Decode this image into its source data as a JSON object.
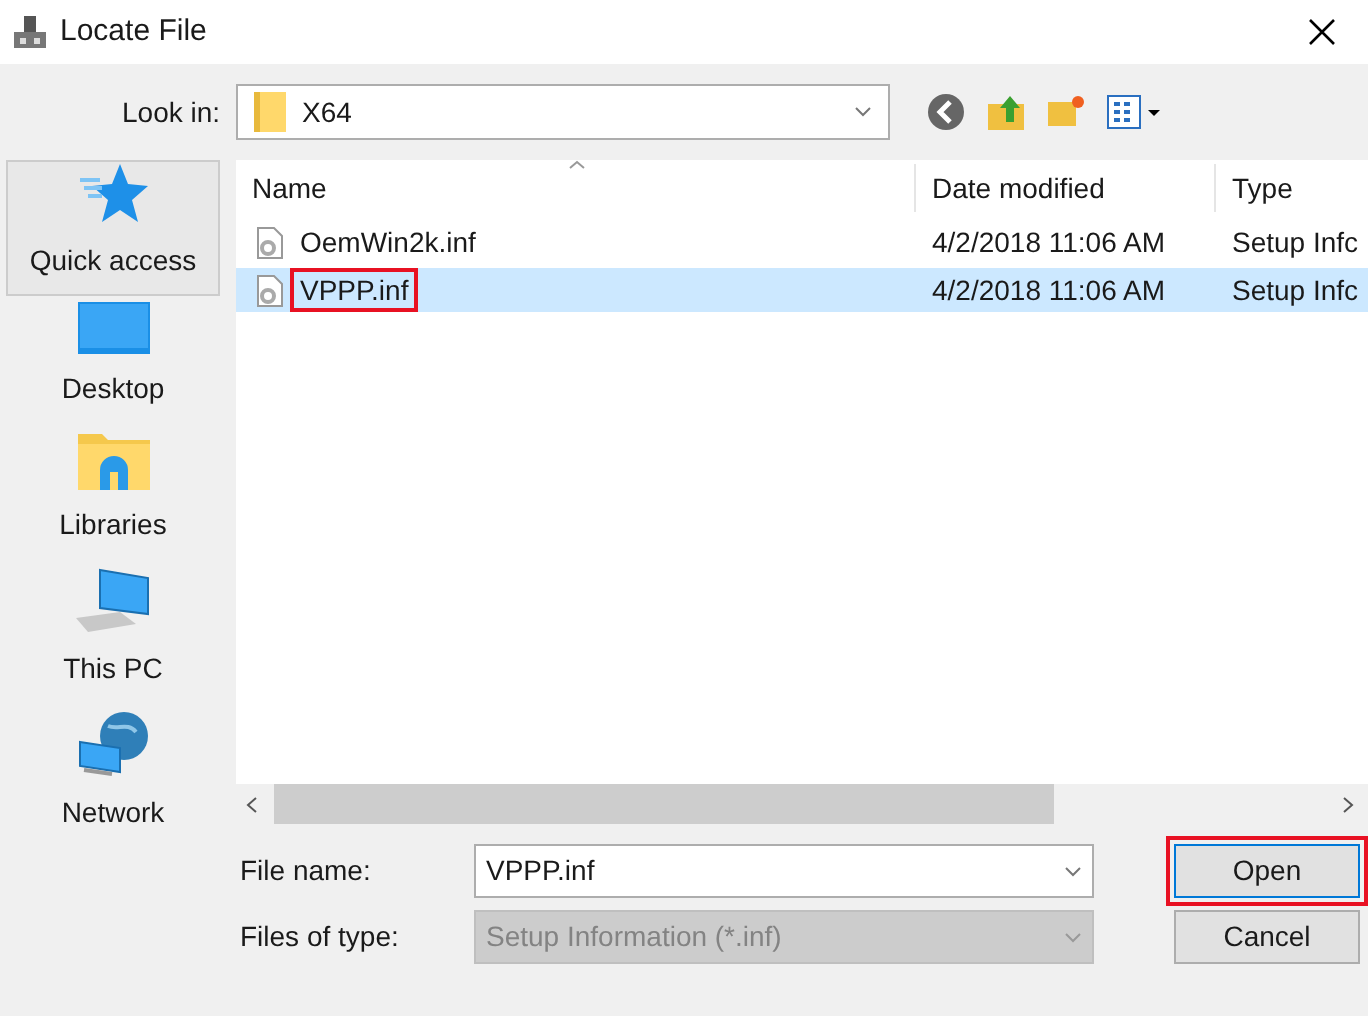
{
  "window": {
    "title": "Locate File"
  },
  "look_in": {
    "label": "Look in:",
    "value": "X64"
  },
  "sidebar": {
    "items": [
      {
        "label": "Quick access",
        "kind": "star",
        "selected": true
      },
      {
        "label": "Desktop",
        "kind": "desktop",
        "selected": false
      },
      {
        "label": "Libraries",
        "kind": "libraries",
        "selected": false
      },
      {
        "label": "This PC",
        "kind": "pc",
        "selected": false
      },
      {
        "label": "Network",
        "kind": "network",
        "selected": false
      }
    ]
  },
  "table": {
    "columns": [
      "Name",
      "Date modified",
      "Type"
    ],
    "rows": [
      {
        "name": "OemWin2k.inf",
        "date": "4/2/2018 11:06 AM",
        "type": "Setup Infc",
        "selected": false,
        "annotated": false
      },
      {
        "name": "VPPP.inf",
        "date": "4/2/2018 11:06 AM",
        "type": "Setup Infc",
        "selected": true,
        "annotated": true
      }
    ]
  },
  "file_name": {
    "label": "File name:",
    "value": "VPPP.inf"
  },
  "file_type": {
    "label": "Files of type:",
    "value": "Setup Information (*.inf)",
    "disabled": true
  },
  "buttons": [
    {
      "label": "Open",
      "annotated": true
    },
    {
      "label": "Cancel",
      "annotated": false
    }
  ]
}
